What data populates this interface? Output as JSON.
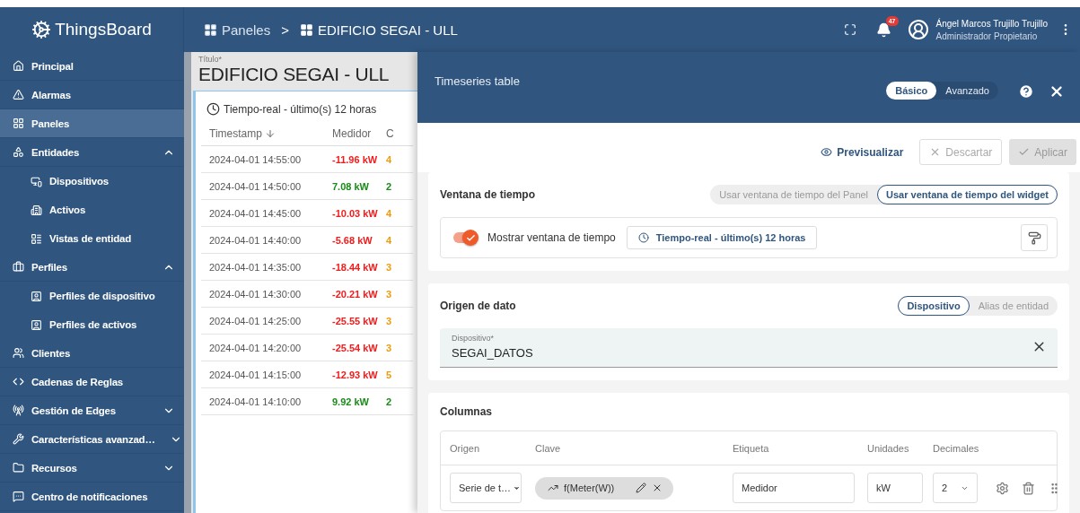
{
  "topbar": {
    "logo": "ThingsBoard",
    "breadcrumbs": [
      "Paneles",
      ">",
      "EDIFICIO SEGAI - ULL"
    ],
    "notification_count": "47",
    "user_name": "Ángel Marcos Trujillo Trujillo",
    "user_role": "Administrador Propietario"
  },
  "sidebar": {
    "items": [
      {
        "label": "Principal",
        "selected": false
      },
      {
        "label": "Alarmas",
        "selected": false
      },
      {
        "label": "Paneles",
        "selected": true
      },
      {
        "label": "Entidades",
        "selected": false,
        "expanded": true,
        "children": [
          {
            "label": "Dispositivos",
            "selected": false
          },
          {
            "label": "Activos",
            "selected": false
          },
          {
            "label": "Vistas de entidad",
            "selected": false
          }
        ]
      },
      {
        "label": "Perfiles",
        "selected": false,
        "expanded": true,
        "children": [
          {
            "label": "Perfiles de dispositivo",
            "selected": false
          },
          {
            "label": "Perfiles de activos",
            "selected": false
          }
        ]
      },
      {
        "label": "Clientes",
        "selected": false
      },
      {
        "label": "Cadenas de Reglas",
        "selected": false
      },
      {
        "label": "Gestión de Edges",
        "selected": false,
        "expanded": false
      },
      {
        "label": "Características avanzad…",
        "selected": false,
        "expanded": false
      },
      {
        "label": "Recursos",
        "selected": false,
        "expanded": false
      },
      {
        "label": "Centro de notificaciones",
        "selected": false
      }
    ]
  },
  "dashboard": {
    "title_label": "Título*",
    "title": "EDIFICIO SEGAI - ULL",
    "widget": {
      "timewindow": "Tiempo-real - último(s) 12 horas",
      "columns": [
        "Timestamp",
        "Medidor",
        "C"
      ],
      "rows": [
        {
          "timestamp": "2024-04-01 14:55:00",
          "meter": {
            "value": "-11.96 kW",
            "color": "#f21b1b"
          },
          "column_3": {
            "value": "4",
            "color": "#ec9b0c"
          }
        },
        {
          "timestamp": "2024-04-01 14:50:00",
          "meter": {
            "value": "7.08 kW",
            "color": "#188b18"
          },
          "column_3": {
            "value": "2",
            "color": "#188b18"
          }
        },
        {
          "timestamp": "2024-04-01 14:45:00",
          "meter": {
            "value": "-10.03 kW",
            "color": "#f21b1b"
          },
          "column_3": {
            "value": "4",
            "color": "#ec9b0c"
          }
        },
        {
          "timestamp": "2024-04-01 14:40:00",
          "meter": {
            "value": "-5.68 kW",
            "color": "#f21b1b"
          },
          "column_3": {
            "value": "4",
            "color": "#ec9b0c"
          }
        },
        {
          "timestamp": "2024-04-01 14:35:00",
          "meter": {
            "value": "-18.44 kW",
            "color": "#f21b1b"
          },
          "column_3": {
            "value": "3",
            "color": "#ec9b0c"
          }
        },
        {
          "timestamp": "2024-04-01 14:30:00",
          "meter": {
            "value": "-20.21 kW",
            "color": "#f21b1b"
          },
          "column_3": {
            "value": "3",
            "color": "#ec9b0c"
          }
        },
        {
          "timestamp": "2024-04-01 14:25:00",
          "meter": {
            "value": "-25.55 kW",
            "color": "#f21b1b"
          },
          "column_3": {
            "value": "3",
            "color": "#ec9b0c"
          }
        },
        {
          "timestamp": "2024-04-01 14:20:00",
          "meter": {
            "value": "-25.54 kW",
            "color": "#f21b1b"
          },
          "column_3": {
            "value": "3",
            "color": "#ec9b0c"
          }
        },
        {
          "timestamp": "2024-04-01 14:15:00",
          "meter": {
            "value": "-12.93 kW",
            "color": "#f21b1b"
          },
          "column_3": {
            "value": "5",
            "color": "#ec9b0c"
          }
        },
        {
          "timestamp": "2024-04-01 14:10:00",
          "meter": {
            "value": "9.92 kW",
            "color": "#188b18"
          },
          "column_3": {
            "value": "2",
            "color": "#188b18"
          }
        }
      ]
    }
  },
  "editor": {
    "title": "Timeseries table",
    "modes": [
      {
        "label": "Básico",
        "selected": true
      },
      {
        "label": "Avanzado",
        "selected": false
      }
    ],
    "actions": [
      {
        "label": "Previsualizar",
        "kind": "preview"
      },
      {
        "label": "Descartar",
        "kind": "discard",
        "disabled": true
      },
      {
        "label": "Aplicar",
        "kind": "apply",
        "disabled": true
      }
    ],
    "timewindow_card": {
      "title": "Ventana de tiempo",
      "options": [
        {
          "label": "Usar ventana de tiempo del Panel",
          "selected": false
        },
        {
          "label": "Usar ventana de tiempo del widget",
          "selected": true
        }
      ],
      "show_toggle": {
        "label": "Mostrar ventana de tiempo",
        "on": true
      },
      "timewindow": "Tiempo-real - último(s) 12 horas"
    },
    "datasource_card": {
      "title": "Origen de dato",
      "options": [
        {
          "label": "Dispositivo",
          "selected": true
        },
        {
          "label": "Alias de entidad",
          "selected": false
        }
      ],
      "device_field": {
        "label": "Dispositivo*",
        "value": "SEGAI_DATOS"
      }
    },
    "columns_card": {
      "title": "Columnas",
      "headers": [
        "Origen",
        "Clave",
        "Etiqueta",
        "Unidades",
        "Decimales"
      ],
      "rows": [
        {
          "origin": "Serie de t…",
          "key": "f(Meter(W))",
          "label": "Medidor",
          "units": "kW",
          "decimals": "2"
        }
      ]
    }
  }
}
